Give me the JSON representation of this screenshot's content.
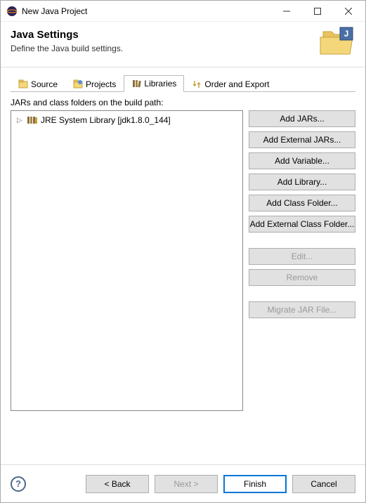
{
  "window": {
    "title": "New Java Project"
  },
  "header": {
    "title": "Java Settings",
    "subtitle": "Define the Java build settings."
  },
  "tabs": {
    "source": "Source",
    "projects": "Projects",
    "libraries": "Libraries",
    "order": "Order and Export"
  },
  "content": {
    "label": "JARs and class folders on the build path:",
    "tree_item": "JRE System Library [jdk1.8.0_144]"
  },
  "buttons": {
    "add_jars": "Add JARs...",
    "add_external_jars": "Add External JARs...",
    "add_variable": "Add Variable...",
    "add_library": "Add Library...",
    "add_class_folder": "Add Class Folder...",
    "add_external_class_folder": "Add External Class Folder...",
    "edit": "Edit...",
    "remove": "Remove",
    "migrate": "Migrate JAR File..."
  },
  "footer": {
    "back": "< Back",
    "next": "Next >",
    "finish": "Finish",
    "cancel": "Cancel"
  }
}
